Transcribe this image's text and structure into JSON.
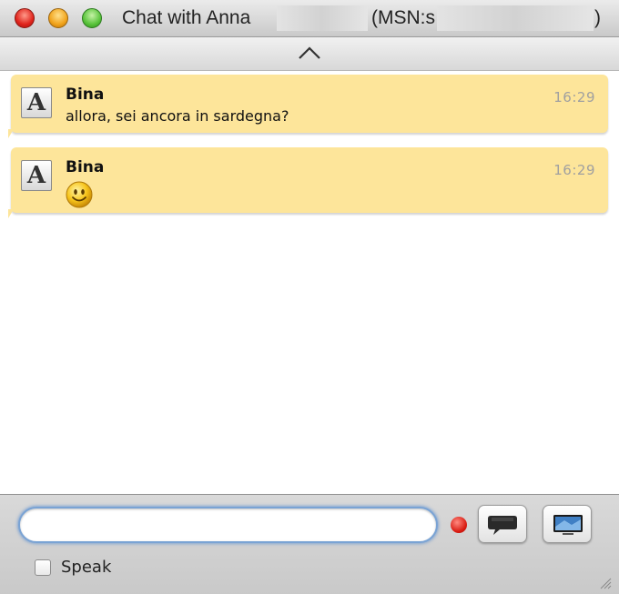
{
  "window": {
    "title": "Chat with Anna",
    "title_suffix": "(MSN:s",
    "title_close": ")"
  },
  "scroll": {
    "icon": "chevron-up-icon"
  },
  "messages": [
    {
      "sender": "Bina",
      "text": "allora, sei ancora in sardegna?",
      "time": "16:29",
      "avatar_icon": "font-a-icon"
    },
    {
      "sender": "Bina",
      "text": "",
      "emoticon": "smiley-icon",
      "time": "16:29",
      "avatar_icon": "font-a-icon"
    }
  ],
  "avatar_letter": "A",
  "composer": {
    "input_value": "",
    "record_icon": "record-dot-icon",
    "buttons": [
      {
        "icon": "speech-bubble-icon"
      },
      {
        "icon": "video-screen-icon"
      }
    ],
    "speak_label": "Speak",
    "speak_checked": false
  },
  "colors": {
    "bubble": "#fde59a",
    "input_focus": "#7aa3d4",
    "close": "#e0231b",
    "minimize": "#f1a31b",
    "zoom": "#58c33a",
    "record": "#d81a10"
  }
}
